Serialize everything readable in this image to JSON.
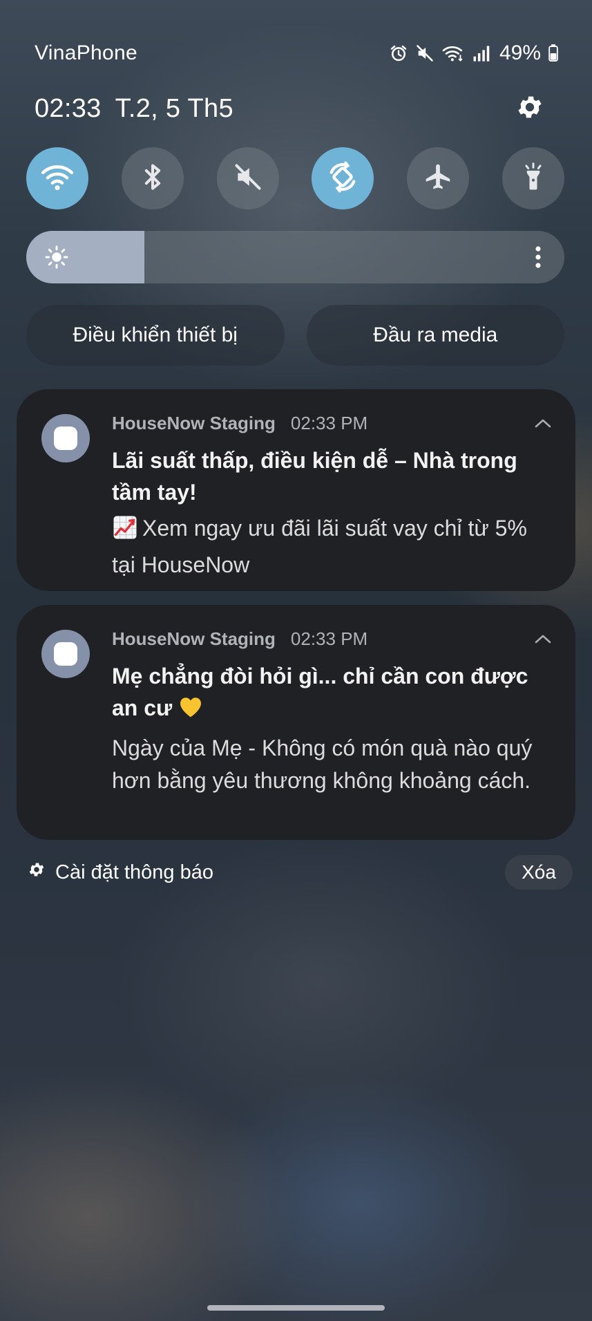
{
  "status_bar": {
    "carrier": "VinaPhone",
    "battery_percent": "49%",
    "icons": [
      "alarm-icon",
      "mute-icon",
      "wifi-icon",
      "signal-icon",
      "battery-icon"
    ]
  },
  "header": {
    "time": "02:33",
    "date": "T.2, 5 Th5",
    "settings_icon": "gear-icon"
  },
  "quick_toggles": [
    {
      "name": "wifi",
      "icon": "wifi-icon",
      "active": true
    },
    {
      "name": "bluetooth",
      "icon": "bluetooth-icon",
      "active": false
    },
    {
      "name": "sound",
      "icon": "mute-icon",
      "active": false
    },
    {
      "name": "auto-rotate",
      "icon": "rotate-icon",
      "active": true
    },
    {
      "name": "airplane-mode",
      "icon": "airplane-icon",
      "active": false
    },
    {
      "name": "flashlight",
      "icon": "flashlight-icon",
      "active": false
    }
  ],
  "brightness": {
    "level_percent": 22,
    "icon": "sun-icon",
    "more_icon": "more-vertical-icon"
  },
  "pills": {
    "device_control": "Điều khiển thiết bị",
    "media_output": "Đầu ra media"
  },
  "notifications": [
    {
      "app": "HouseNow Staging",
      "time": "02:33 PM",
      "title": "Lãi suất thấp, điều kiện dễ – Nhà trong tầm tay!",
      "text": "Xem ngay ưu đãi lãi suất vay chỉ từ 5% tại HouseNow",
      "emoji": "chart-increasing-icon"
    },
    {
      "app": "HouseNow Staging",
      "time": "02:33 PM",
      "title": "Mẹ chẳng đòi hỏi gì... chỉ cần con được an cư",
      "text": "Ngày của Mẹ - Không có món quà nào quý hơn bằng yêu thương không khoảng cách.",
      "emoji": "yellow-heart-icon"
    }
  ],
  "footer": {
    "notification_settings": "Cài đặt thông báo",
    "clear": "Xóa"
  },
  "colors": {
    "toggle_active": "#6fb3d6",
    "notification_bg": "#1f2124",
    "app_icon_bg": "#8590a9"
  }
}
